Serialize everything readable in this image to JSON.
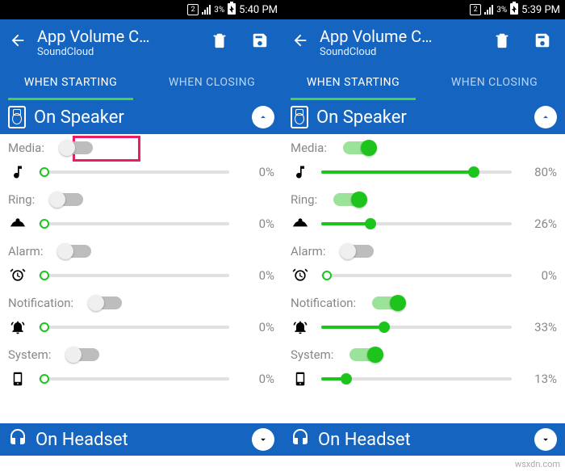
{
  "watermark": "wsxdn.com",
  "panes": [
    {
      "status": {
        "sim": "2",
        "battery": "3%",
        "time": "5:40 PM"
      },
      "appbar": {
        "title": "App Volume C…",
        "subtitle": "SoundCloud"
      },
      "tabs": {
        "starting": "WHEN STARTING",
        "closing": "WHEN CLOSING"
      },
      "section_speaker": "On Speaker",
      "section_headset": "On Headset",
      "rows": {
        "media": {
          "label": "Media:",
          "on": false,
          "pct": "0%",
          "val": 0
        },
        "ring": {
          "label": "Ring:",
          "on": false,
          "pct": "0%",
          "val": 0
        },
        "alarm": {
          "label": "Alarm:",
          "on": false,
          "pct": "0%",
          "val": 0
        },
        "notification": {
          "label": "Notification:",
          "on": false,
          "pct": "0%",
          "val": 0
        },
        "system": {
          "label": "System:",
          "on": false,
          "pct": "0%",
          "val": 0
        }
      },
      "highlight": true
    },
    {
      "status": {
        "sim": "2",
        "battery": "3%",
        "time": "5:39 PM"
      },
      "appbar": {
        "title": "App Volume C…",
        "subtitle": "SoundCloud"
      },
      "tabs": {
        "starting": "WHEN STARTING",
        "closing": "WHEN CLOSING"
      },
      "section_speaker": "On Speaker",
      "section_headset": "On Headset",
      "rows": {
        "media": {
          "label": "Media:",
          "on": true,
          "pct": "80%",
          "val": 80
        },
        "ring": {
          "label": "Ring:",
          "on": true,
          "pct": "26%",
          "val": 26
        },
        "alarm": {
          "label": "Alarm:",
          "on": false,
          "pct": "0%",
          "val": 0
        },
        "notification": {
          "label": "Notification:",
          "on": true,
          "pct": "33%",
          "val": 33
        },
        "system": {
          "label": "System:",
          "on": true,
          "pct": "13%",
          "val": 13
        }
      },
      "highlight": false
    }
  ]
}
